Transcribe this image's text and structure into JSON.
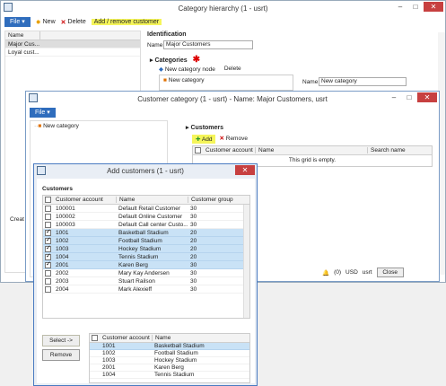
{
  "bg_window": {
    "title": "Category hierarchy (1 - usrt)",
    "file": "File",
    "new": "New",
    "delete": "Delete",
    "add_remove": "Add / remove customer",
    "list_header": "Name",
    "list": [
      "Major Cus...",
      "Loyal cust..."
    ],
    "identification": "Identification",
    "name_label": "Name:",
    "name_value": "Major Customers",
    "categories": "Categories",
    "new_category_node": "New category node",
    "cat_delete": "Delete",
    "tree_item": "New category",
    "name_label2": "Name:",
    "name_value2": "New category",
    "creat": "Creat"
  },
  "mid_window": {
    "title": "Customer category (1 - usrt) - Name: Major Customers, usrt",
    "file": "File",
    "tree_item": "New category",
    "customers": "Customers",
    "add": "Add",
    "remove": "Remove",
    "col_account": "Customer account",
    "col_name": "Name",
    "col_search": "Search name",
    "empty": "This grid is empty."
  },
  "status": {
    "count": "(0)",
    "currency": "USD",
    "user": "usrt",
    "close": "Close"
  },
  "dialog": {
    "title": "Add customers (1 - usrt)",
    "section": "Customers",
    "col_account": "Customer account",
    "col_name": "Name",
    "col_group": "Customer group",
    "rows": [
      {
        "account": "100001",
        "name": "Default Retail Customer",
        "group": "30",
        "checked": false,
        "sel": false
      },
      {
        "account": "100002",
        "name": "Default Online Customer",
        "group": "30",
        "checked": false,
        "sel": false
      },
      {
        "account": "100003",
        "name": "Default Call center Custo...",
        "group": "30",
        "checked": false,
        "sel": false
      },
      {
        "account": "1001",
        "name": "Basketball Stadium",
        "group": "20",
        "checked": true,
        "sel": true
      },
      {
        "account": "1002",
        "name": "Football Stadium",
        "group": "20",
        "checked": true,
        "sel": true
      },
      {
        "account": "1003",
        "name": "Hockey Stadium",
        "group": "20",
        "checked": true,
        "sel": true
      },
      {
        "account": "1004",
        "name": "Tennis Stadium",
        "group": "20",
        "checked": true,
        "sel": true
      },
      {
        "account": "2001",
        "name": "Karen Berg",
        "group": "30",
        "checked": true,
        "sel": true
      },
      {
        "account": "2002",
        "name": "Mary Kay Andersen",
        "group": "30",
        "checked": false,
        "sel": false
      },
      {
        "account": "2003",
        "name": "Stuart Railson",
        "group": "30",
        "checked": false,
        "sel": false
      },
      {
        "account": "2004",
        "name": "Mark Alexieff",
        "group": "30",
        "checked": false,
        "sel": false
      }
    ],
    "select": "Select ->",
    "remove": "Remove",
    "bottom_rows": [
      {
        "account": "1001",
        "name": "Basketball Stadium"
      },
      {
        "account": "1002",
        "name": "Football Stadium"
      },
      {
        "account": "1003",
        "name": "Hockey Stadium"
      },
      {
        "account": "2001",
        "name": "Karen Berg"
      },
      {
        "account": "1004",
        "name": "Tennis Stadium"
      }
    ]
  },
  "colors": {
    "accent": "#2f6dbd",
    "highlight": "#f5f55a",
    "selected_row": "#c9e2f6",
    "close": "#c74040"
  }
}
